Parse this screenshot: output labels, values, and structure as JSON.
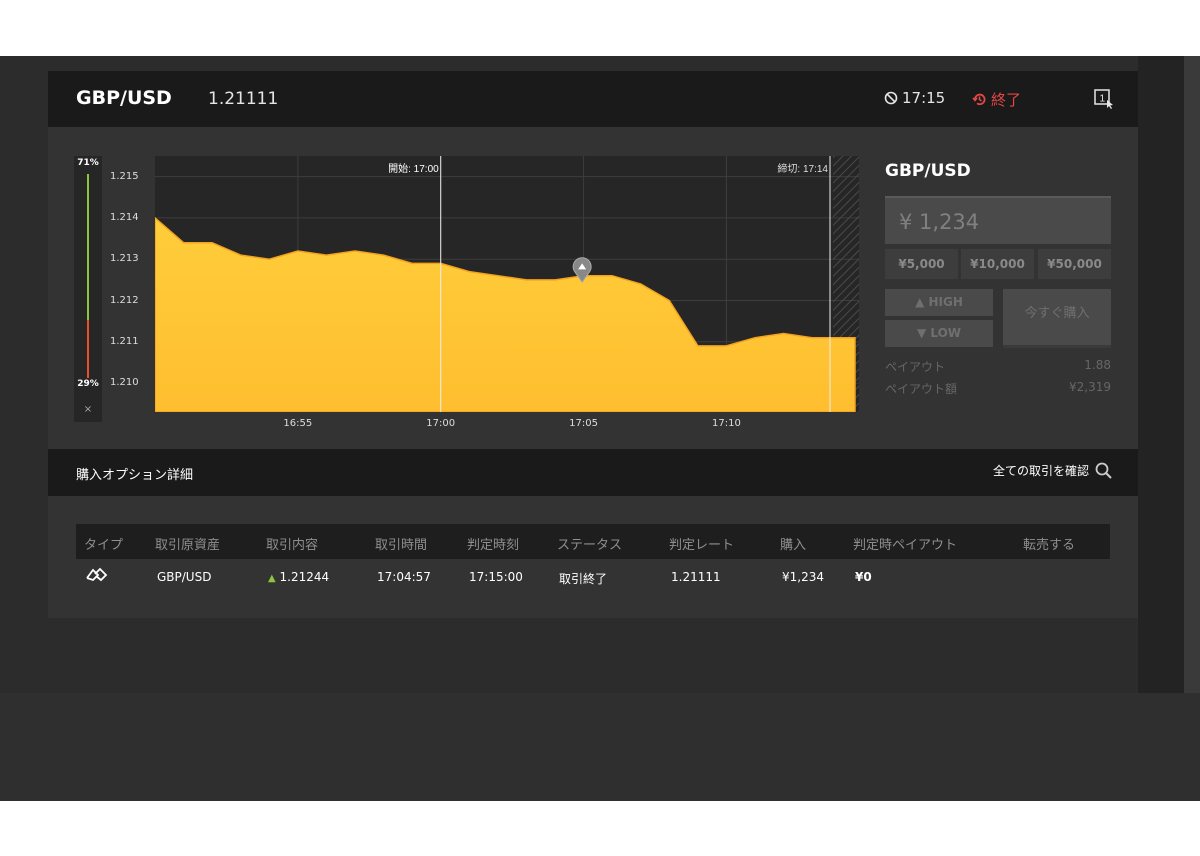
{
  "header": {
    "pair": "GBP/USD",
    "price": "1.21111",
    "timer": "17:15",
    "status": "終了",
    "status_color": "#e34747"
  },
  "probability": {
    "high": "71%",
    "low": "29%",
    "close": "×"
  },
  "chart_data": {
    "type": "area",
    "xlabel": "",
    "ylabel": "",
    "ylim": [
      1.2093,
      1.2155
    ],
    "y_ticks": [
      "1.215",
      "1.214",
      "1.213",
      "1.212",
      "1.211",
      "1.210"
    ],
    "x_ticks": [
      "16:55",
      "17:00",
      "17:05",
      "17:10"
    ],
    "start_label": "開始: 17:00",
    "end_label": "締切: 17:14",
    "series": [
      {
        "color": "#ffc93c",
        "points": [
          [
            "16:50",
            1.214
          ],
          [
            "16:51",
            1.2134
          ],
          [
            "16:52",
            1.2134
          ],
          [
            "16:53",
            1.2131
          ],
          [
            "16:54",
            1.213
          ],
          [
            "16:55",
            1.2132
          ],
          [
            "16:56",
            1.2131
          ],
          [
            "16:57",
            1.2132
          ],
          [
            "16:58",
            1.2131
          ],
          [
            "16:59",
            1.2129
          ],
          [
            "17:00",
            1.2129
          ],
          [
            "17:01",
            1.2127
          ],
          [
            "17:02",
            1.2126
          ],
          [
            "17:03",
            1.2125
          ],
          [
            "17:04",
            1.2125
          ],
          [
            "17:05",
            1.2126
          ],
          [
            "17:06",
            1.2126
          ],
          [
            "17:07",
            1.2124
          ],
          [
            "17:08",
            1.212
          ],
          [
            "17:09",
            1.2109
          ],
          [
            "17:10",
            1.2109
          ],
          [
            "17:11",
            1.2111
          ],
          [
            "17:12",
            1.2112
          ],
          [
            "17:13",
            1.2111
          ],
          [
            "17:14",
            1.2111
          ],
          [
            "17:14:30",
            1.2111
          ]
        ]
      }
    ],
    "marker": {
      "time": "17:04:57",
      "value": 1.21244,
      "icon": "high-arrow-pin-icon"
    }
  },
  "order": {
    "title": "GBP/USD",
    "amount": "¥ 1,234",
    "presets": [
      "¥5,000",
      "¥10,000",
      "¥50,000"
    ],
    "high_label": "HIGH",
    "low_label": "LOW",
    "buy_label": "今すぐ購入",
    "payout_label": "ペイアウト",
    "payout_value": "1.88",
    "payout_amount_label": "ペイアウト額",
    "payout_amount_value": "¥2,319"
  },
  "details": {
    "title": "購入オプション詳細",
    "link": "全ての取引を確認",
    "columns": [
      "タイプ",
      "取引原資産",
      "取引内容",
      "取引時間",
      "判定時刻",
      "ステータス",
      "判定レート",
      "購入",
      "判定時ペイアウト",
      "転売する"
    ],
    "rows": [
      {
        "type_icon": "high-low-type-icon",
        "asset": "GBP/USD",
        "direction_icon": "high-arrow-icon",
        "content": "1.21244",
        "time": "17:04:57",
        "judge_time": "17:15:00",
        "status": "取引終了",
        "rate": "1.21111",
        "purchase": "¥1,234",
        "payout": "¥0"
      }
    ]
  }
}
